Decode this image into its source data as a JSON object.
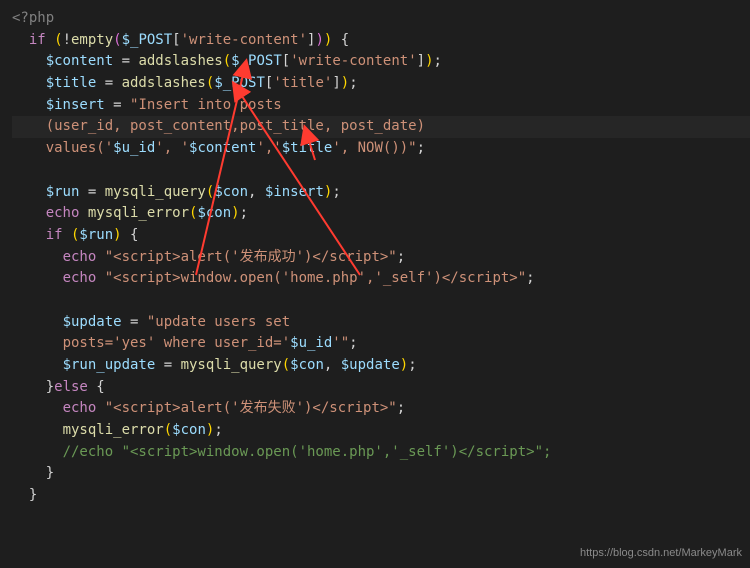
{
  "code": {
    "l1_open_php": "<?php",
    "l2_if": "if",
    "l2_open_outer": " (",
    "l2_neg": "!",
    "l2_empty": "empty",
    "l2_open_inner": "(",
    "l2_post": "$_POST",
    "l2_br_open": "[",
    "l2_str": "'write-content'",
    "l2_br_close": "]",
    "l2_close_inner": ")",
    "l2_close_outer": ")",
    "l2_brace": " {",
    "l3_var": "$content",
    "l3_eq": " = ",
    "l3_fn": "addslashes",
    "l3_open": "(",
    "l3_post": "$_POST",
    "l3_br_open": "[",
    "l3_str": "'write-content'",
    "l3_br_close": "]",
    "l3_close": ")",
    "l3_semi": ";",
    "l4_var": "$title",
    "l4_eq": " = ",
    "l4_fn": "addslashes",
    "l4_open": "(",
    "l4_post": "$_POST",
    "l4_br_open": "[",
    "l4_str": "'title'",
    "l4_br_close": "]",
    "l4_close": ")",
    "l4_semi": ";",
    "l5_var": "$insert",
    "l5_eq": " = ",
    "l5_str": "\"Insert into posts ",
    "l6_str": "(user_id, post_content,post_title, post_date) ",
    "l7_str_a": "values('",
    "l7_var1": "$u_id",
    "l7_str_b": "', '",
    "l7_var2": "$content",
    "l7_str_c": "','",
    "l7_var3": "$title",
    "l7_str_d": "', NOW())\"",
    "l7_semi": ";",
    "l9_var": "$run",
    "l9_eq": " = ",
    "l9_fn": "mysqli_query",
    "l9_open": "(",
    "l9_a1": "$con",
    "l9_comma": ", ",
    "l9_a2": "$insert",
    "l9_close": ")",
    "l9_semi": ";",
    "l10_echo": "echo",
    "l10_sp": " ",
    "l10_fn": "mysqli_error",
    "l10_open": "(",
    "l10_a1": "$con",
    "l10_close": ")",
    "l10_semi": ";",
    "l11_if": "if",
    "l11_open": " (",
    "l11_var": "$run",
    "l11_close": ")",
    "l11_brace": " {",
    "l12_echo": "echo",
    "l12_sp": " ",
    "l12_str": "\"<script>alert('发布成功')</scr",
    "l12_str_tail": "ipt>\"",
    "l12_semi": ";",
    "l13_echo": "echo",
    "l13_sp": " ",
    "l13_str": "\"<script>window.open('home.php','_self')</scr",
    "l13_str_tail": "ipt>\"",
    "l13_semi": ";",
    "l15_var": "$update",
    "l15_eq": " = ",
    "l15_str": "\"update users set ",
    "l16_str_a": "posts='yes' where user_id='",
    "l16_var": "$u_id",
    "l16_str_b": "'\"",
    "l16_semi": ";",
    "l17_var": "$run_update",
    "l17_eq": " = ",
    "l17_fn": "mysqli_query",
    "l17_open": "(",
    "l17_a1": "$con",
    "l17_comma": ", ",
    "l17_a2": "$update",
    "l17_close": ")",
    "l17_semi": ";",
    "l18_close_brace": "}",
    "l18_else": "else",
    "l18_open_brace": " {",
    "l19_echo": "echo",
    "l19_sp": " ",
    "l19_str": "\"<script>alert('发布失败')</scr",
    "l19_str_tail": "ipt>\"",
    "l19_semi": ";",
    "l20_fn": "mysqli_error",
    "l20_open": "(",
    "l20_a1": "$con",
    "l20_close": ")",
    "l20_semi": ";",
    "l21_cmt": "//echo \"<script>window.open('home.php','_self')</scr",
    "l21_cmt_tail": "ipt>\";",
    "l22_close_brace": "}",
    "l23_close_brace": "}"
  },
  "watermark": "https://blog.csdn.net/MarkeyMark"
}
